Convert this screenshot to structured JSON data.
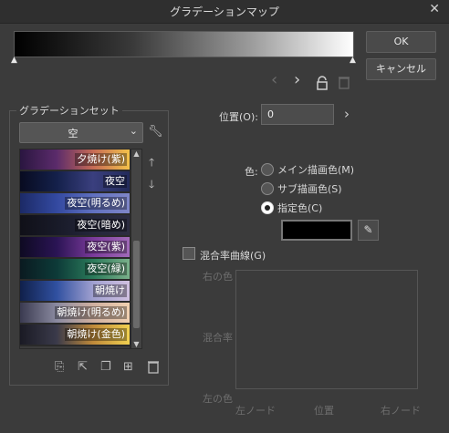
{
  "window": {
    "title": "グラデーションマップ",
    "close": "✕"
  },
  "buttons": {
    "ok": "OK",
    "cancel": "キャンセル"
  },
  "gradient": {
    "start_color": "#000000",
    "end_color": "#ffffff"
  },
  "toolbar_icons": [
    "chevron-left-icon",
    "chevron-right-icon",
    "lock-icon",
    "trash-icon"
  ],
  "gradient_set": {
    "group_label": "グラデーションセット",
    "selected": "空",
    "items": [
      {
        "label": "夕焼け(紫)",
        "colors": [
          "#2a1640",
          "#5b2b6b",
          "#c66a55",
          "#f3c24a"
        ]
      },
      {
        "label": "夜空",
        "colors": [
          "#080b20",
          "#14204a",
          "#3a3f7e",
          "#222a5a"
        ]
      },
      {
        "label": "夜空(明るめ)",
        "colors": [
          "#1c2a66",
          "#3349a0",
          "#6070c0",
          "#7f86c8"
        ]
      },
      {
        "label": "夜空(暗め)",
        "colors": [
          "#101018",
          "#181a28",
          "#24263a",
          "#2c2c40"
        ]
      },
      {
        "label": "夜空(紫)",
        "colors": [
          "#0e0a22",
          "#2a1454",
          "#7a3a9a",
          "#a06ab8"
        ]
      },
      {
        "label": "夜空(緑)",
        "colors": [
          "#0a1a20",
          "#0d3a38",
          "#2a7a5a",
          "#7ab08a"
        ]
      },
      {
        "label": "朝焼け",
        "colors": [
          "#10204a",
          "#3050a0",
          "#a0a0d0",
          "#d0c0e0"
        ]
      },
      {
        "label": "朝焼け(明るめ)",
        "colors": [
          "#3a3a50",
          "#8a8aa0",
          "#d0b0a0",
          "#f0d0b0"
        ]
      },
      {
        "label": "朝焼け(金色)",
        "colors": [
          "#1a1a24",
          "#3a3a4a",
          "#c08a3a",
          "#f0d050"
        ]
      }
    ]
  },
  "position": {
    "label": "位置(O):",
    "value": "0"
  },
  "color": {
    "label": "色:",
    "options": [
      "メイン描画色(M)",
      "サブ描画色(S)",
      "指定色(C)"
    ],
    "selected_index": 2,
    "swatch": "#000000"
  },
  "blend_curve": {
    "checkbox_label": "混合率曲線(G)",
    "checked": false,
    "y_top": "右の色",
    "y_mid": "混合率",
    "y_bottom": "左の色",
    "x_left": "左ノード",
    "x_mid": "位置",
    "x_right": "右ノード"
  }
}
